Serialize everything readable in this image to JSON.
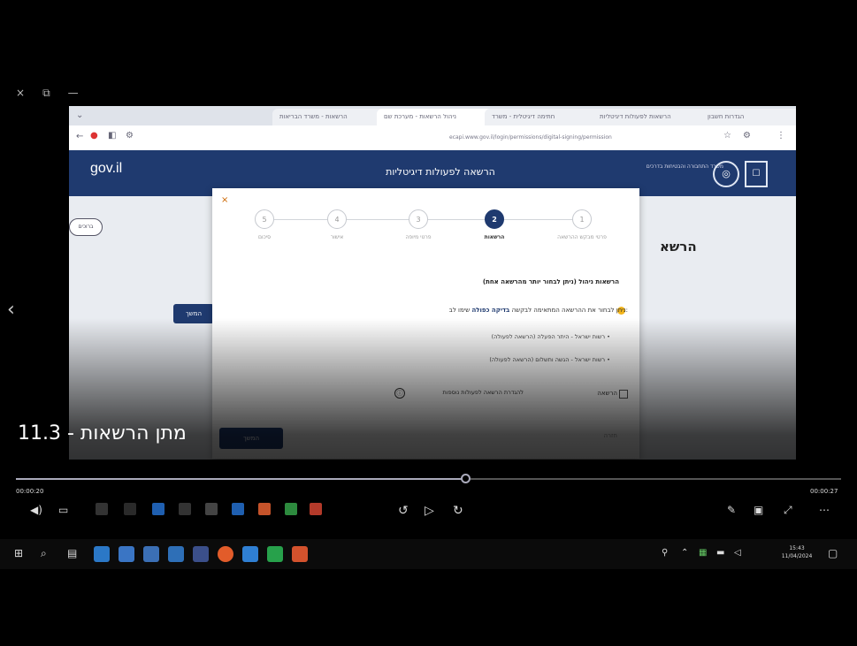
{
  "window_controls": [
    "×",
    "⧉",
    "—"
  ],
  "browser": {
    "tabs": [
      {
        "label": "הרשאות - משרד הבריאות",
        "active": false
      },
      {
        "label": "ניהול הרשאות - מערכת שם",
        "active": true
      },
      {
        "label": "חתימה דיגיטלית - משרד",
        "active": false
      },
      {
        "label": "הרשאות לפעולות דיגיטליות",
        "active": false
      },
      {
        "label": "הגדרות חשבון",
        "active": false
      }
    ],
    "url": "ecapi.www.gov.il/login/permissions/digital-signing/permission"
  },
  "gov_header": {
    "logo": "gov.il",
    "title": "הרשאה לפעולות דיגיטליות",
    "ministry": "משרד התחבורה והבטיחות בדרכים"
  },
  "page": {
    "pill_label": "ברוכים",
    "heading": "הרשא",
    "blue_button": "המשך"
  },
  "modal": {
    "close": "×",
    "steps": [
      {
        "number": "5",
        "label": "סיכום",
        "active": false
      },
      {
        "number": "4",
        "label": "אישור",
        "active": false
      },
      {
        "number": "3",
        "label": "פרטי מיופה",
        "active": false
      },
      {
        "number": "2",
        "label": "הרשאות",
        "active": true
      },
      {
        "number": "1",
        "label": "פרטי מבקש ההרשאה",
        "active": false
      }
    ],
    "question": "הרשאות ניהול (ניתן לבחור יותר מהרשאה אחת)",
    "note_prefix": "שימו לב:",
    "note_bold": "בדיקה כפולה",
    "note_suffix": "ניתן לבחור את ההרשאה המתאימה לבקשה",
    "bullets": [
      "רשות ישראל - היתר הפעלה (הרשאה לפעולה)",
      "רשות ישראל - הגשה ותשלום (הרשאה לפעולה)"
    ],
    "checkbox_label": "הרשאה",
    "info_link": "להגדרת הרשאה לפעולות נוספות",
    "info_icon": "ⓘ",
    "next_button": "המשך",
    "back_button": "חזרה"
  },
  "overlay": {
    "lesson_title": "11.3 - מתן הרשאות"
  },
  "player": {
    "time_elapsed": "00:00:20",
    "time_total": "00:00:27",
    "progress_fraction": 0.545
  },
  "tray": {
    "time": "15:43",
    "date": "11/04/2024"
  }
}
